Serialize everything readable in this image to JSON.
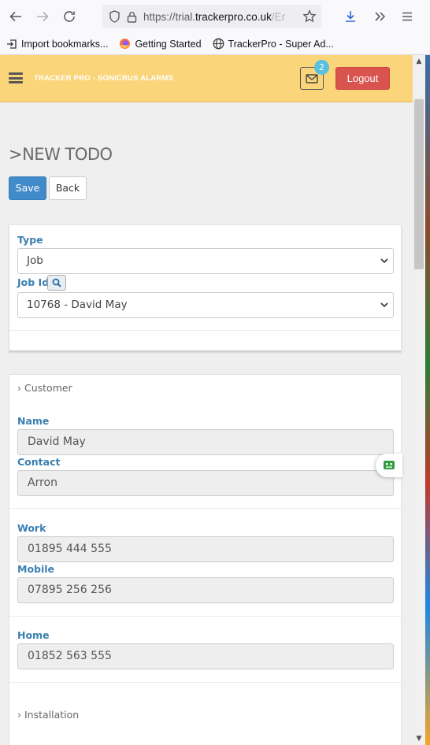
{
  "browser": {
    "url_prefix": "https://trial.",
    "url_domain": "trackerpro.co.uk",
    "url_suffix": "/Er",
    "bookmarks": [
      {
        "label": "Import bookmarks..."
      },
      {
        "label": "Getting Started"
      },
      {
        "label": "TrackerPro - Super Ad..."
      }
    ]
  },
  "header": {
    "brand": "TRACKER PRO - SONICRUS ALARMS",
    "mail_count": "2",
    "logout_label": "Logout"
  },
  "page": {
    "title": ">NEW TODO",
    "save_label": "Save",
    "back_label": "Back"
  },
  "form": {
    "type_label": "Type",
    "type_value": "Job",
    "job_id_label": "Job Id",
    "job_id_value": "10768 - David May"
  },
  "customer": {
    "section_label": "Customer",
    "name_label": "Name",
    "name_value": "David May",
    "contact_label": "Contact",
    "contact_value": "Arron",
    "work_label": "Work",
    "work_value": "01895 444 555",
    "mobile_label": "Mobile",
    "mobile_value": "07895 256 256",
    "home_label": "Home",
    "home_value": "01852 563 555"
  },
  "installation": {
    "section_label": "Installation"
  },
  "colors": {
    "header_bg": "#fbd57a",
    "primary": "#428bca",
    "danger": "#d9534f",
    "label": "#3a7fb0",
    "badge": "#5bc0de"
  }
}
